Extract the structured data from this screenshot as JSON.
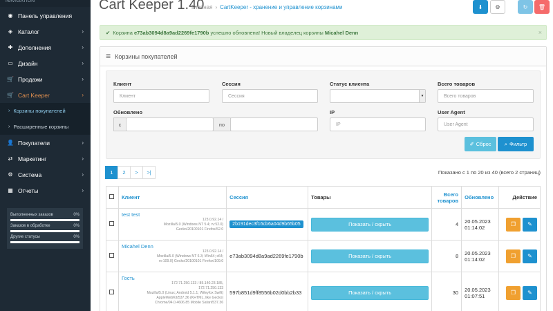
{
  "sidebar": {
    "nav_heading": "NAVIGATION",
    "items": [
      {
        "icon": "dashboard-icon",
        "label": "Панель управления",
        "chevron": false
      },
      {
        "icon": "tag-icon",
        "label": "Каталог",
        "chevron": true
      },
      {
        "icon": "puzzle-icon",
        "label": "Дополнения",
        "chevron": true
      },
      {
        "icon": "monitor-icon",
        "label": "Дизайн",
        "chevron": true
      },
      {
        "icon": "cart-icon",
        "label": "Продажи",
        "chevron": true
      },
      {
        "icon": "cart-icon",
        "label": "Cart Keeper",
        "chevron": true,
        "active": true
      }
    ],
    "submenu": [
      {
        "label": "Корзины покупателей",
        "active": true
      },
      {
        "label": "Расширенные корзины",
        "active": false
      }
    ],
    "items2": [
      {
        "icon": "user-icon",
        "label": "Покупатели",
        "chevron": true
      },
      {
        "icon": "share-icon",
        "label": "Маркетинг",
        "chevron": true
      },
      {
        "icon": "gear-icon",
        "label": "Система",
        "chevron": true
      },
      {
        "icon": "bar-chart-icon",
        "label": "Отчеты",
        "chevron": true
      }
    ],
    "stats": [
      {
        "label": "Выполненных заказов",
        "value": "0%"
      },
      {
        "label": "Заказов в обработке",
        "value": "0%"
      },
      {
        "label": "Другие статусы",
        "value": "0%"
      }
    ]
  },
  "header": {
    "title": "Cart Keeper 1.40",
    "breadcrumb": [
      "Главная",
      "CartKeeper - хранение и управление корзинами"
    ],
    "breadcrumb_sep": "›"
  },
  "alert": {
    "prefix": "Корзина",
    "cart_id": "e73ab3094d8a9ad2269fe1790b",
    "middle": "успешно обновлена! Новый владелец корзины",
    "owner": "Micahel Denn"
  },
  "panel": {
    "title": "Корзины покупателей"
  },
  "filter": {
    "client_label": "Клиент",
    "client_placeholder": "Клиент",
    "session_label": "Сессия",
    "session_placeholder": "Сессия",
    "status_label": "Статус клиента",
    "total_label": "Всего товаров",
    "total_placeholder": "Всего товаров",
    "updated_label": "Обновлено",
    "from_addon": "с",
    "to_addon": "по",
    "ip_label": "IP",
    "ip_placeholder": "IP",
    "ua_label": "User Agent",
    "ua_placeholder": "User Agent",
    "reset_label": "Сброс",
    "filter_label": "Фильтр"
  },
  "pagination": {
    "pages": [
      "1",
      "2",
      ">",
      ">|"
    ],
    "showing": "Показано с 1 по 20 из 40 (всего 2 страниц)"
  },
  "table": {
    "headers": {
      "client": "Клиент",
      "session": "Сессия",
      "products": "Товары",
      "total": "Всего товаров",
      "updated": "Обновлено",
      "actions": "Действие"
    },
    "toggle_label": "Показать / скрыть",
    "rows": [
      {
        "name": "test test",
        "info": [
          "123.0.92.14 /",
          "Mozilla/5.0 (Windows NT 5.4; rv:52.0)",
          "Gecko/20100101 Firefox/52.0"
        ],
        "session": "2b191dec3f16cb6a04d9b65b05",
        "total": "4",
        "date": "20.05.2023",
        "time": "01:14:02"
      },
      {
        "name": "Micahel Denn",
        "info": [
          "123.0.92.14 /",
          "Mozilla/5.0 (Windows NT 6.3; Win64; x64;",
          "rv:109.0) Gecko/20100101 Firefox/109.0"
        ],
        "session": "e73ab3094d8a9ad2269fe1790b",
        "total": "8",
        "date": "20.05.2023",
        "time": "01:14:02"
      },
      {
        "name": "Гость",
        "info": [
          "172.71.250.133 / 85.140.23.185,",
          "172.71.250.133",
          "Mozilla/5.0 (Linux; Android 5.1.1; Wileyfox Swift)",
          "AppleWebKit/537.36 (KHTML, like Gecko)",
          "Chrome/94.0.4606.85 Mobile Safari/537.36"
        ],
        "session": "597b851d9ff8556b02d0bb2b33",
        "total": "30",
        "date": "20.05.2023",
        "time": "01:07:51"
      }
    ]
  },
  "colors": {
    "sidebar_bg": "#1e2a35",
    "accent": "#1e91cf",
    "active_menu": "#e08f4f",
    "info_btn": "#5bc0de",
    "warning_btn": "#f0a030",
    "danger_btn": "#f56b6b"
  }
}
